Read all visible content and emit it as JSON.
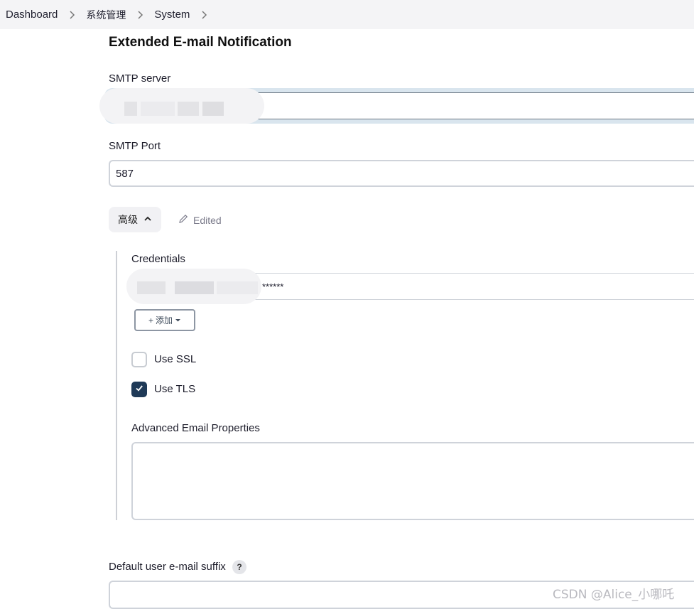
{
  "breadcrumb": {
    "items": [
      {
        "label": "Dashboard"
      },
      {
        "label": "系统管理"
      },
      {
        "label": "System"
      }
    ]
  },
  "section": {
    "title": "Extended E-mail Notification"
  },
  "smtp_server": {
    "label": "SMTP server",
    "value": ""
  },
  "smtp_port": {
    "label": "SMTP Port",
    "value": "587"
  },
  "advanced": {
    "button_label": "高级",
    "edited_label": "Edited",
    "credentials": {
      "label": "Credentials",
      "value_suffix": "******",
      "add_button_label": "添加"
    },
    "use_ssl": {
      "label": "Use SSL",
      "checked": false
    },
    "use_tls": {
      "label": "Use TLS",
      "checked": true
    },
    "email_properties": {
      "label": "Advanced Email Properties",
      "value": ""
    }
  },
  "default_suffix": {
    "label": "Default user e-mail suffix",
    "help": "?"
  },
  "watermark": "CSDN @Alice_小哪吒",
  "colors": {
    "topbar_bg": "#f4f4f6",
    "checkbox_checked": "#1f3a57",
    "focus_ring": "#d9e5ee"
  },
  "icons": {
    "breadcrumb_separator": "chevron-right-icon",
    "advanced_toggle": "chevron-up-icon",
    "edited": "pencil-icon",
    "add_dropdown": "caret-down-icon",
    "checkmark": "check-icon"
  }
}
